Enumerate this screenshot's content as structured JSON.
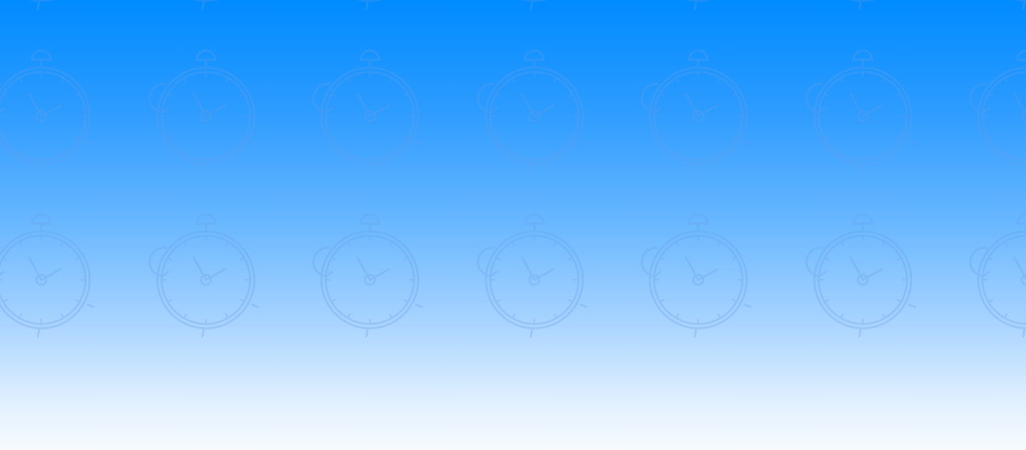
{
  "background": {
    "gradient_top": "#008bff",
    "gradient_bottom": "#f6faff",
    "pattern_icon": "alarm-clock-icon",
    "pattern_stroke": "#6a9fe6"
  }
}
